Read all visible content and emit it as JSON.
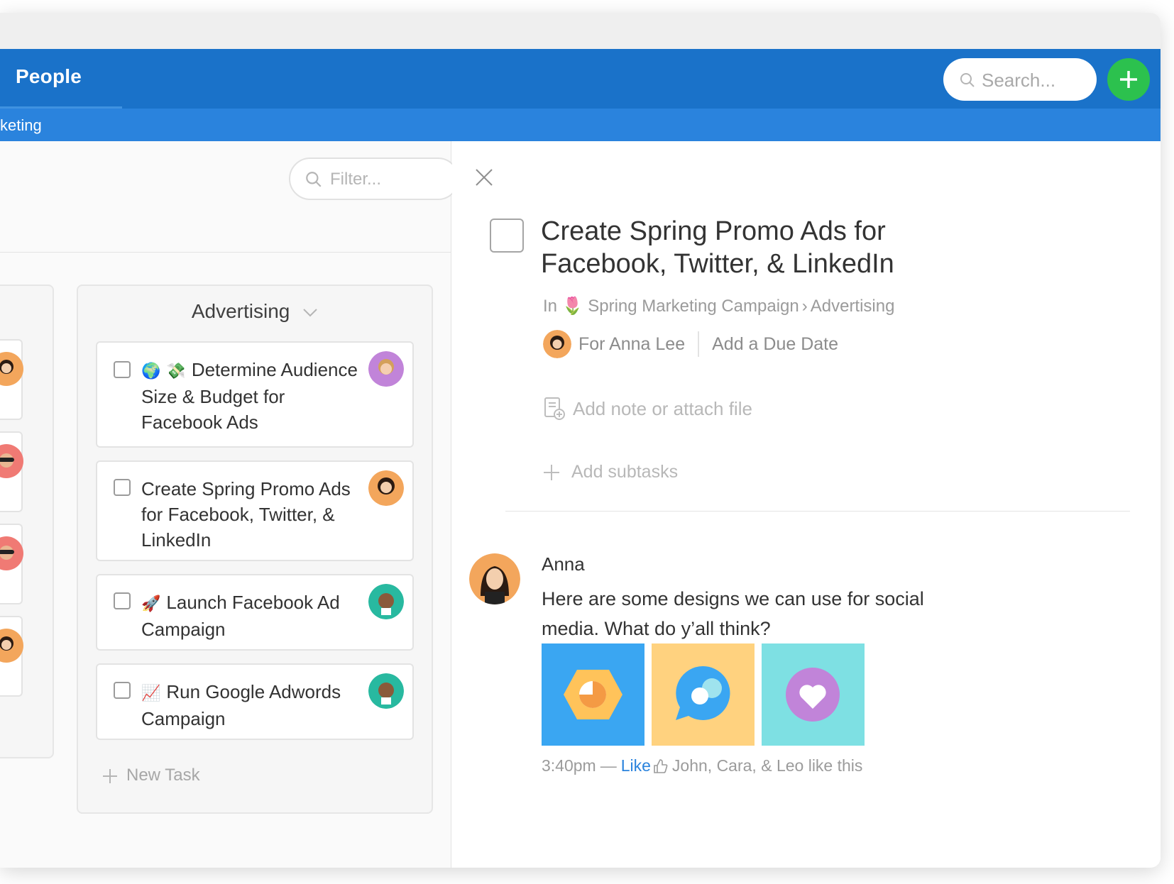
{
  "header": {
    "title": "People",
    "search_placeholder": "Search...",
    "breadcrumb": "keting"
  },
  "board": {
    "filter_placeholder": "Filter...",
    "column": {
      "title": "Advertising",
      "cards": [
        {
          "emojis": [
            "🌍",
            "💸"
          ],
          "text": "Determine Audience Size & Budget for Facebook Ads"
        },
        {
          "emojis": [],
          "text": "Create Spring Promo Ads for Facebook, Twitter, & LinkedIn"
        },
        {
          "emojis": [
            "🚀"
          ],
          "text": "Launch Facebook Ad Campaign"
        },
        {
          "emojis": [
            "📈"
          ],
          "text": "Run Google Adwords Campaign"
        }
      ],
      "new_task_label": "New Task"
    }
  },
  "detail": {
    "title": "Create Spring Promo Ads for Facebook, Twitter, & LinkedIn",
    "breadcrumb": {
      "prefix": "In",
      "emoji": "🌷",
      "project": "Spring Marketing Campaign",
      "separator": "›",
      "section": "Advertising"
    },
    "assignee_label": "For Anna Lee",
    "due_date_label": "Add a Due Date",
    "note_placeholder": "Add note or attach file",
    "subtasks_label": "Add subtasks",
    "comment": {
      "author": "Anna",
      "text": "Here are some designs we can use for social media. What do y’all think?",
      "time": "3:40pm",
      "dash": "—",
      "like_label": "Like",
      "likes_text": "John, Cara, & Leo like this"
    }
  },
  "colors": {
    "topbar": "#1a72c9",
    "subbar": "#2a83dd",
    "add_button": "#2cc14e",
    "thumb_blue": "#3aa6f2",
    "thumb_yellow": "#ffd27f",
    "thumb_teal": "#7ee0e3"
  }
}
